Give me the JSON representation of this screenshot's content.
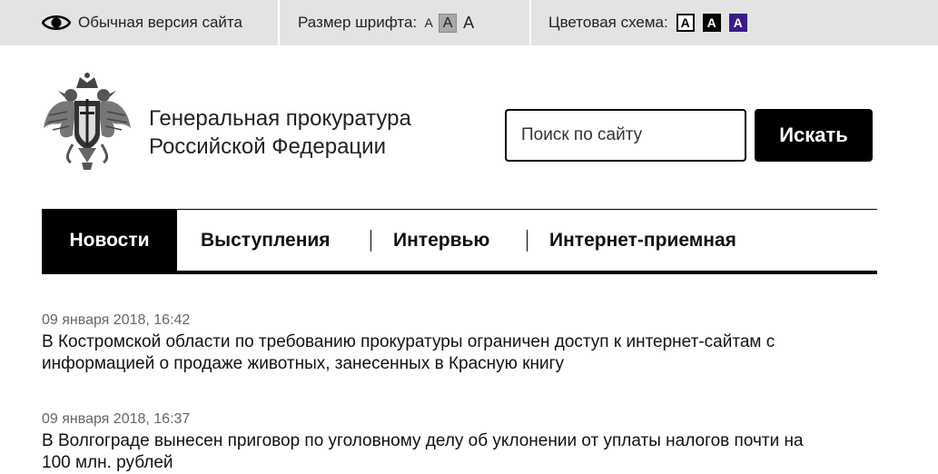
{
  "topbar": {
    "normal_version_label": "Обычная версия сайта",
    "font_size_label": "Размер шрифта:",
    "font_size_options": [
      "A",
      "A",
      "A"
    ],
    "color_scheme_label": "Цветовая схема:",
    "color_scheme_options": [
      "A",
      "A",
      "A"
    ],
    "icons": {
      "normal_version": "eye-icon"
    }
  },
  "header": {
    "title_line1": "Генеральная прокуратура",
    "title_line2": "Российской Федерации",
    "logo": "emblem-double-headed-eagle"
  },
  "search": {
    "placeholder": "Поиск по сайту",
    "button_label": "Искать"
  },
  "nav": {
    "tabs": [
      {
        "label": "Новости",
        "active": true
      },
      {
        "label": "Выступления",
        "active": false
      },
      {
        "label": "Интервью",
        "active": false
      },
      {
        "label": "Интернет-приемная",
        "active": false
      }
    ]
  },
  "news": [
    {
      "date": "09 января 2018, 16:42",
      "title_line1": "В Костромской области по требованию прокуратуры ограничен доступ к интернет-сайтам с",
      "title_line2": "информацией о продаже животных, занесенных в Красную книгу"
    },
    {
      "date": "09 января 2018, 16:37",
      "title_line1": "В Волгограде вынесен приговор по уголовному делу об уклонении от уплаты налогов почти на",
      "title_line2": "100 млн. рублей"
    }
  ],
  "colors": {
    "topbar_bg": "#e3e3e3",
    "accent": "#000000",
    "scheme_blue": "#3b1a8a",
    "date_text": "#666666"
  }
}
